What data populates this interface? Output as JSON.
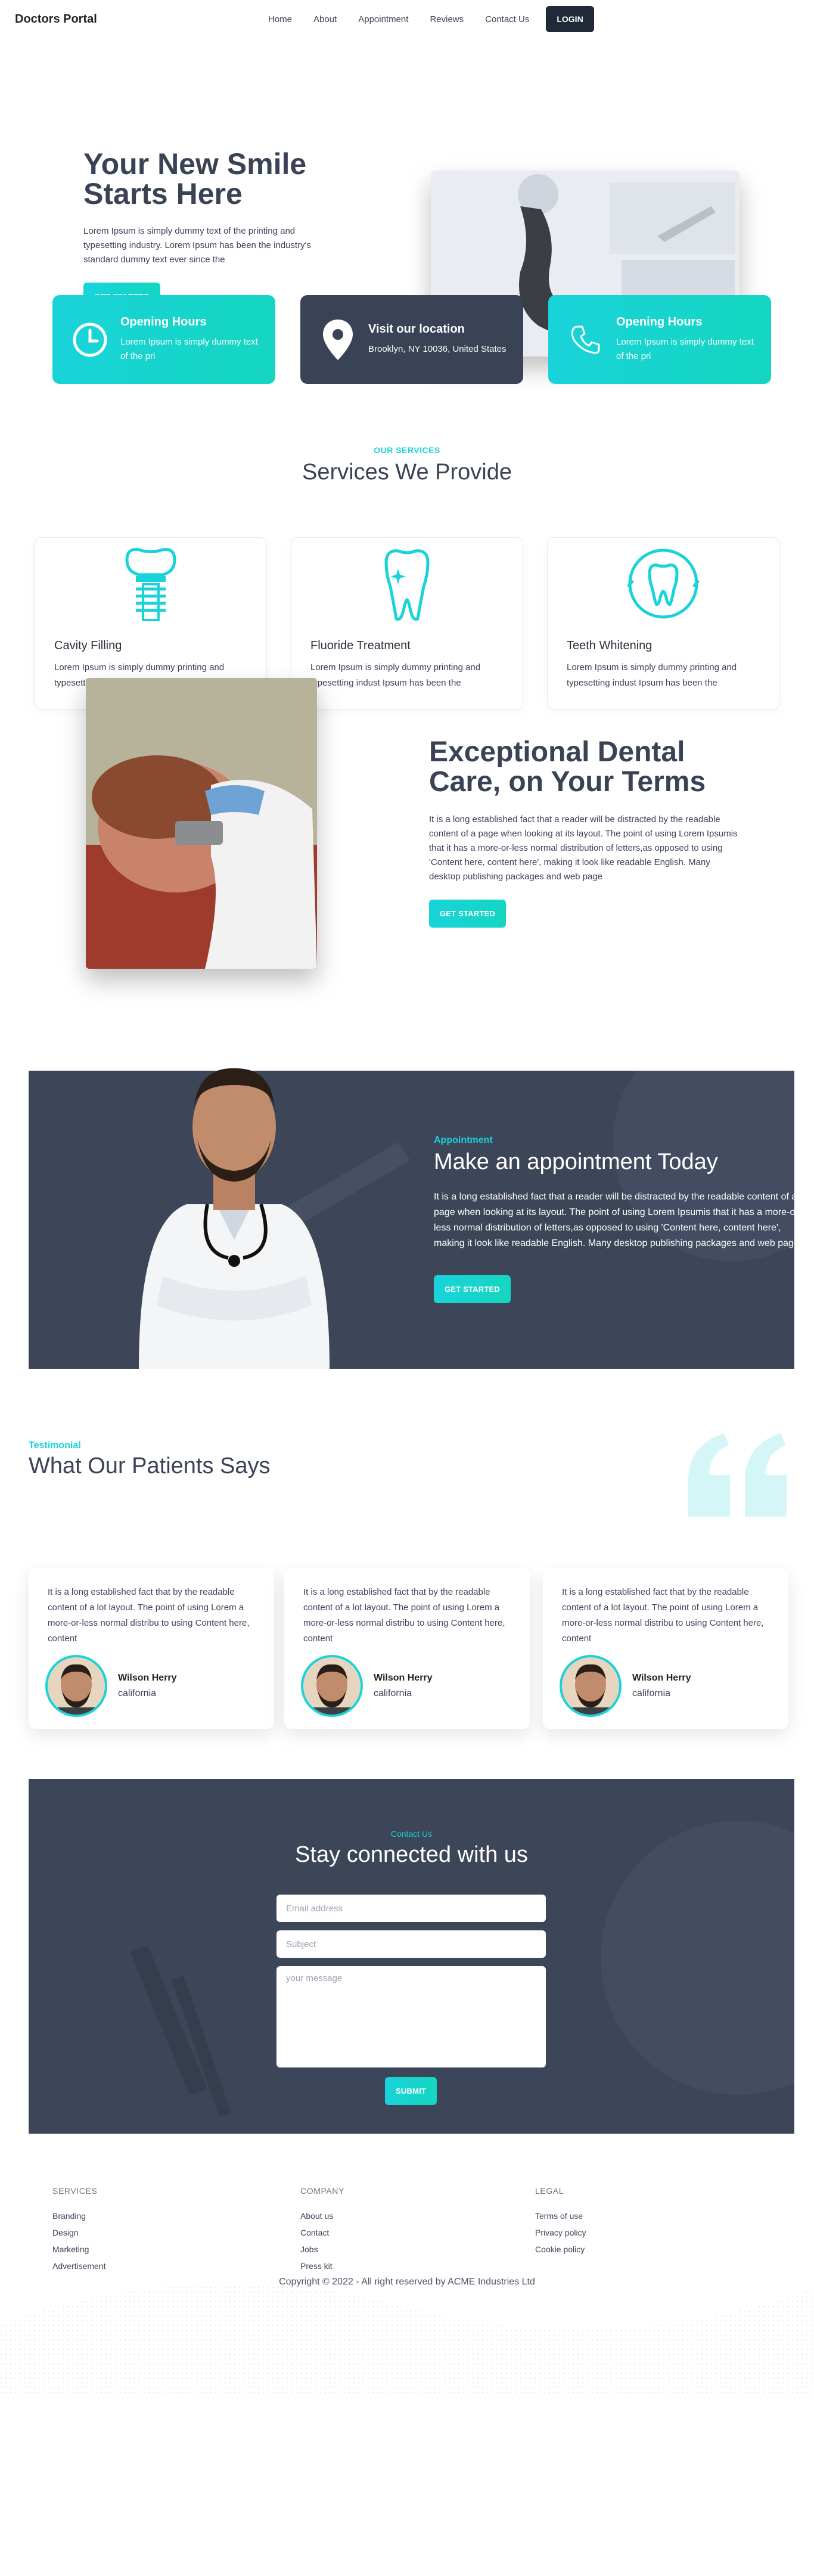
{
  "nav": {
    "brand": "Doctors Portal",
    "links": [
      "Home",
      "About",
      "Appointment",
      "Reviews",
      "Contact Us"
    ],
    "login": "LOGIN"
  },
  "hero": {
    "title": "Your New Smile Starts Here",
    "desc": "Lorem Ipsum is simply dummy text of the printing and typesetting industry. Lorem Ipsum has been the industry's standard dummy text ever since the",
    "button": "GET STARTED"
  },
  "info": [
    {
      "title": "Opening Hours",
      "text": "Lorem Ipsum is simply dummy text of the pri",
      "icon": "clock-icon"
    },
    {
      "title": "Visit our location",
      "text": "Brooklyn, NY 10036, United States",
      "icon": "location-pin-icon"
    },
    {
      "title": "Opening Hours",
      "text": "Lorem Ipsum is simply dummy text of the pri",
      "icon": "phone-icon"
    }
  ],
  "services": {
    "kicker": "OUR SERVICES",
    "title": "Services We Provide",
    "items": [
      {
        "title": "Cavity Filling",
        "desc": "Lorem Ipsum is simply dummy printing and typesetting indust Ipsum has been the",
        "icon": "dental-implant-icon"
      },
      {
        "title": "Fluoride Treatment",
        "desc": "Lorem Ipsum is simply dummy printing and typesetting indust Ipsum has been the",
        "icon": "sparkling-tooth-icon"
      },
      {
        "title": "Teeth Whitening",
        "desc": "Lorem Ipsum is simply dummy printing and typesetting indust Ipsum has been the",
        "icon": "tooth-whitening-icon"
      }
    ]
  },
  "exceptional": {
    "title": "Exceptional Dental Care, on Your Terms",
    "desc": "It is a long established fact that a reader will be distracted by the readable content of a page when looking at its layout. The point of using Lorem Ipsumis that it has a more-or-less normal distribution of letters,as opposed to using 'Content here, content here', making it look like readable English. Many desktop publishing packages and web page",
    "button": "GET STARTED"
  },
  "appointment": {
    "kicker": "Appointment",
    "title": "Make an appointment Today",
    "desc": "It is a long established fact that a reader will be distracted by the readable content of a page when looking at its layout. The point of using Lorem Ipsumis that it has a more-or-less normal distribution of letters,as opposed to using 'Content here, content here', making it look like readable English. Many desktop publishing packages and web page",
    "button": "GET STARTED"
  },
  "testimonials": {
    "kicker": "Testimonial",
    "title": "What Our Patients Says",
    "items": [
      {
        "text": "It is a long established fact that by the readable content of a lot layout. The point of using Lorem a more-or-less normal distribu to using Content here, content",
        "name": "Wilson Herry",
        "location": "california"
      },
      {
        "text": "It is a long established fact that by the readable content of a lot layout. The point of using Lorem a more-or-less normal distribu to using Content here, content",
        "name": "Wilson Herry",
        "location": "california"
      },
      {
        "text": "It is a long established fact that by the readable content of a lot layout. The point of using Lorem a more-or-less normal distribu to using Content here, content",
        "name": "Wilson Herry",
        "location": "california"
      }
    ]
  },
  "contact": {
    "kicker": "Contact Us",
    "title": "Stay connected with us",
    "email_placeholder": "Email address",
    "subject_placeholder": "Subject",
    "message_placeholder": "your message",
    "submit": "SUBMIT"
  },
  "footer": {
    "columns": [
      {
        "heading": "SERVICES",
        "links": [
          "Branding",
          "Design",
          "Marketing",
          "Advertisement"
        ]
      },
      {
        "heading": "COMPANY",
        "links": [
          "About us",
          "Contact",
          "Jobs",
          "Press kit"
        ]
      },
      {
        "heading": "LEGAL",
        "links": [
          "Terms of use",
          "Privacy policy",
          "Cookie policy"
        ]
      }
    ],
    "copyright": "Copyright © 2022 - All right reserved by ACME Industries Ltd"
  },
  "colors": {
    "accent": "#19d3da",
    "dark": "#3a4256",
    "panel": "#3d4558"
  }
}
